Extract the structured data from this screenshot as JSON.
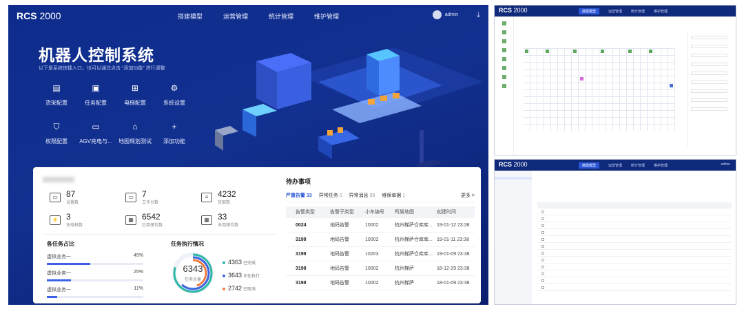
{
  "hero": {
    "logo_main": "RCS",
    "logo_num": "2000",
    "nav": [
      "搭建模型",
      "运营管理",
      "统计管理",
      "维护管理"
    ],
    "user": "admin",
    "title": "机器人控制系统",
    "subtitle": "以下是系统快捷入口，也可以通过点击 “添加功能” 进行调整",
    "quick_links": [
      {
        "label": "货架配置",
        "icon": "shelf-icon"
      },
      {
        "label": "任务配置",
        "icon": "task-icon"
      },
      {
        "label": "电梯配置",
        "icon": "elevator-icon"
      },
      {
        "label": "系统设置",
        "icon": "gear-icon"
      },
      {
        "label": "权限配置",
        "icon": "shield-icon"
      },
      {
        "label": "AGV充电与...",
        "icon": "battery-icon"
      },
      {
        "label": "地图规划测试",
        "icon": "map-icon"
      },
      {
        "label": "添加功能",
        "icon": "plus-icon"
      }
    ]
  },
  "stats": [
    {
      "value": "87",
      "label": "设备数",
      "icon": "device-icon"
    },
    {
      "value": "7",
      "label": "工作台数",
      "icon": "monitor-icon"
    },
    {
      "value": "4232",
      "label": "货架数",
      "icon": "shelf-icon"
    },
    {
      "value": "3",
      "label": "充电桩数",
      "icon": "charger-icon"
    },
    {
      "value": "6542",
      "label": "已用储位数",
      "icon": "grid-icon"
    },
    {
      "value": "33",
      "label": "未用储位数",
      "icon": "grid-icon"
    }
  ],
  "task_ratio": {
    "title": "各任务占比",
    "items": [
      {
        "label": "虚拟业务一",
        "value": "45%",
        "fraction": 0.45
      },
      {
        "label": "虚拟业务一",
        "value": "25%",
        "fraction": 0.25
      },
      {
        "label": "虚拟业务一",
        "value": "11%",
        "fraction": 0.11
      }
    ]
  },
  "task_exec": {
    "title": "任务执行情况",
    "total": "6343",
    "total_label": "任务总量",
    "legend": [
      {
        "value": "4363",
        "label": "已完成",
        "color": "#2bb6a6"
      },
      {
        "value": "3643",
        "label": "正在执行",
        "color": "#3b63e3"
      },
      {
        "value": "2742",
        "label": "已取消",
        "color": "#f07a3a"
      }
    ]
  },
  "todo": {
    "title": "待办事项",
    "tabs": [
      {
        "label": "严重告警",
        "count": "33"
      },
      {
        "label": "异常任务",
        "count": "0"
      },
      {
        "label": "异常消息",
        "count": "99"
      },
      {
        "label": "维保单据",
        "count": "1"
      }
    ],
    "more": "更多 >",
    "columns": [
      "告警类型",
      "告警子类型",
      "小车编号",
      "所属地图",
      "创建时间"
    ],
    "rows": [
      [
        "0024",
        "地码告警",
        "10002",
        "杭州梯萨仓库库...",
        "19-01-12 23:38"
      ],
      [
        "3198",
        "地码告警",
        "10002",
        "杭州梯萨仓库库...",
        "19-01-11 23:38"
      ],
      [
        "3198",
        "地码告警",
        "10203",
        "杭州梯萨仓库库...",
        "19-01-09 23:38"
      ],
      [
        "3198",
        "地码告警",
        "10002",
        "杭州梯萨",
        "18-12-29 23:38"
      ],
      [
        "3198",
        "地码告警",
        "10002",
        "杭州梯萨",
        "18-01-09 23:38"
      ]
    ]
  },
  "shot1": {
    "logo_main": "RCS",
    "logo_num": "2000",
    "nav": [
      "搭建模型",
      "运营管理",
      "统计管理",
      "维护管理"
    ]
  },
  "shot2": {
    "logo_main": "RCS",
    "logo_num": "2000",
    "nav": [
      "搭建模型",
      "运营管理",
      "统计管理",
      "维护管理"
    ],
    "user": "admin"
  }
}
